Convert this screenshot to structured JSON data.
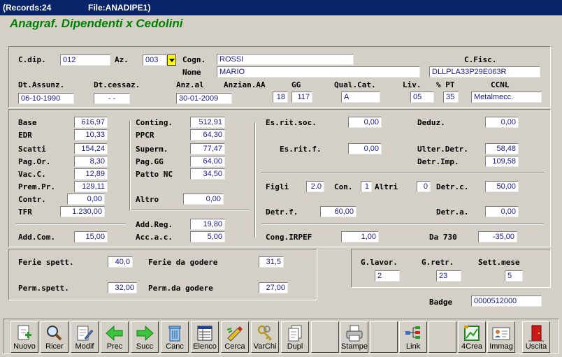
{
  "window": {
    "records": "(Records:24",
    "file": "File:ANADIPE1)"
  },
  "heading": "Anagraf. Dipendenti x Cedolini",
  "anag": {
    "cdip_label": "C.dip.",
    "cdip": "012",
    "az_label": "Az.",
    "az": "003",
    "cogn_label": "Cogn.",
    "cogn": "ROSSI",
    "nome_label": "Nome",
    "nome": "MARIO",
    "cfisc_label": "C.Fisc.",
    "cfisc": "DLLPLA33P29E063R",
    "dtassunz_label": "Dt.Assunz.",
    "dtassunz": "06-10-1990",
    "dtcessaz_label": "Dt.cessaz.",
    "dtcessaz": "-  -",
    "anzal_label": "Anz.al",
    "anzal": "30-01-2009",
    "anzianaa_label": "Anzian.AA",
    "anzianaa": "18",
    "gg_label": "GG",
    "gg": "117",
    "qualcat_label": "Qual.Cat.",
    "qualcat": "A",
    "liv_label": "Liv.",
    "liv": "05",
    "pt_label": "% PT",
    "pt": "35",
    "ccnl_label": "CCNL",
    "ccnl": "Metalmecc."
  },
  "pay": {
    "base_label": "Base",
    "base": "616,97",
    "edr_label": "EDR",
    "edr": "10,33",
    "scatti_label": "Scatti",
    "scatti": "154,24",
    "pagor_label": "Pag.Or.",
    "pagor": "8,30",
    "vacc_label": "Vac.C.",
    "vacc": "12,89",
    "prempr_label": "Prem.Pr.",
    "prempr": "129,11",
    "contr_label": "Contr.",
    "contr": "0,00",
    "tfr_label": "TFR",
    "tfr": "1.230,00",
    "conting_label": "Conting.",
    "conting": "512,91",
    "ppcr_label": "PPCR",
    "ppcr": "64,30",
    "superm_label": "Superm.",
    "superm": "77,47",
    "paggg_label": "Pag.GG",
    "paggg": "64,00",
    "pattonc_label": "Patto NC",
    "pattonc": "34,50",
    "altro_label": "Altro",
    "altro": "0,00",
    "addcom_label": "Add.Com.",
    "addcom": "15,00",
    "addreg_label": "Add.Reg.",
    "addreg": "19,80",
    "accac_label": "Acc.a.c.",
    "accac": "5,00"
  },
  "tax": {
    "esritsoc_label": "Es.rit.soc.",
    "esritsoc": "0,00",
    "deduz_label": "Deduz.",
    "deduz": "0,00",
    "esritf_label": "Es.rit.f.",
    "esritf": "0,00",
    "ulterdetr_label": "Ulter.Detr.",
    "ulterdetr": "58,48",
    "detrimp_label": "Detr.Imp.",
    "detrimp": "109,58",
    "figli_label": "Figli",
    "figli": "2.0",
    "con_label": "Con.",
    "con": "1",
    "altri_label": "Altri",
    "altri": "0",
    "detrc_label": "Detr.c.",
    "detrc": "50,00",
    "detrf_label": "Detr.f.",
    "detrf": "60,00",
    "detra_label": "Detr.a.",
    "detra": "0,00",
    "congirpef_label": "Cong.IRPEF",
    "congirpef": "1,00",
    "da730_label": "Da 730",
    "da730": "-35,00"
  },
  "leave": {
    "feriespett_label": "Ferie spett.",
    "feriespett": "40,0",
    "feriegodere_label": "Ferie da godere",
    "feriegodere": "31,5",
    "permspett_label": "Perm.spett.",
    "permspett": "32,00",
    "permgodere_label": "Perm.da godere",
    "permgodere": "27,00"
  },
  "work": {
    "glavor_label": "G.lavor.",
    "glavor": "2",
    "gretr_label": "G.retr.",
    "gretr": "23",
    "settmese_label": "Sett.mese",
    "settmese": "5"
  },
  "badge": {
    "label": "Badge",
    "value": "0000512000"
  },
  "toolbar": {
    "nuovo": "Nuovo",
    "ricer": "Ricer",
    "modif": "Modif",
    "prec": "Prec",
    "succ": "Succ",
    "canc": "Canc",
    "elenco": "Elenco",
    "cerca": "Cerca",
    "varchi": "VarChi",
    "dupl": "Dupl",
    "stampe": "Stampe",
    "link": "Link",
    "crea4": "4Crea",
    "immag": "Immag",
    "uscita": "Uscita"
  },
  "colors": {
    "titlebar": "#0a246a",
    "heading": "#008000",
    "field_text": "#1a1a8c",
    "dropdown": "#ffff00"
  }
}
